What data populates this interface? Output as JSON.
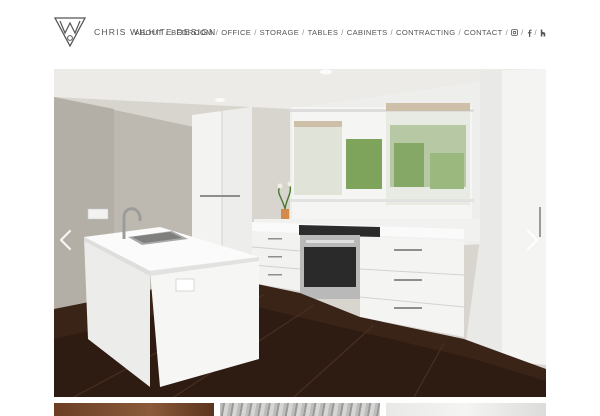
{
  "brand": {
    "name": "CHRIS WILHITE DESIGN"
  },
  "nav": {
    "items": [
      "ABOUT",
      "BEDROOM",
      "OFFICE",
      "STORAGE",
      "TABLES",
      "CABINETS",
      "CONTRACTING",
      "CONTACT"
    ],
    "separator": "/",
    "social": [
      "instagram-icon",
      "facebook-icon",
      "houzz-icon"
    ]
  },
  "slider": {
    "image": "kitchen-photo",
    "prev_icon": "chevron-left-icon",
    "next_icon": "chevron-right-icon"
  },
  "thumbnails": [
    "wood-cabinet-photo",
    "wood-grain-photo",
    "white-room-photo"
  ],
  "colors": {
    "text": "#555555",
    "background": "#ffffff",
    "arrow": "#ffffff"
  }
}
